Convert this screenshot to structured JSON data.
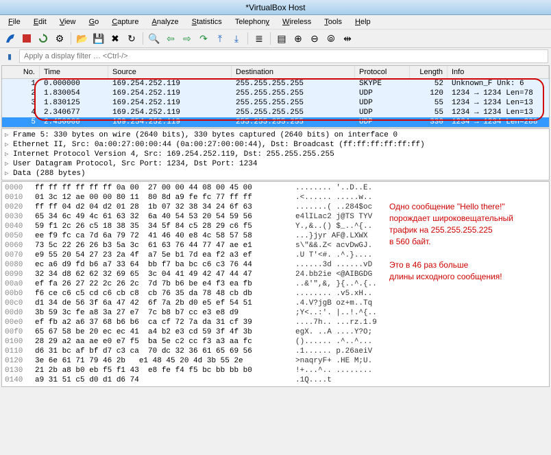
{
  "window": {
    "title": "*VirtualBox Host"
  },
  "menu": {
    "file": "File",
    "edit": "Edit",
    "view": "View",
    "go": "Go",
    "capture": "Capture",
    "analyze": "Analyze",
    "statistics": "Statistics",
    "telephony": "Telephony",
    "wireless": "Wireless",
    "tools": "Tools",
    "help": "Help"
  },
  "filter": {
    "placeholder": "Apply a display filter … <Ctrl-/>"
  },
  "columns": {
    "no": "No.",
    "time": "Time",
    "src": "Source",
    "dst": "Destination",
    "proto": "Protocol",
    "len": "Length",
    "info": "Info"
  },
  "packets": [
    {
      "no": "1",
      "time": "0.000000",
      "src": "169.254.252.119",
      "dst": "255.255.255.255",
      "proto": "SKYPE",
      "len": "52",
      "info": "Unknown_F  Unk: 6",
      "sel": false,
      "grp": true
    },
    {
      "no": "2",
      "time": "1.830054",
      "src": "169.254.252.119",
      "dst": "255.255.255.255",
      "proto": "UDP",
      "len": "120",
      "info": "1234 → 1234 Len=78",
      "sel": false,
      "grp": true
    },
    {
      "no": "3",
      "time": "1.830125",
      "src": "169.254.252.119",
      "dst": "255.255.255.255",
      "proto": "UDP",
      "len": "55",
      "info": "1234 → 1234 Len=13",
      "sel": false,
      "grp": true
    },
    {
      "no": "4",
      "time": "2.340677",
      "src": "169.254.252.119",
      "dst": "255.255.255.255",
      "proto": "UDP",
      "len": "55",
      "info": "1234 → 1234 Len=13",
      "sel": false,
      "grp": true
    },
    {
      "no": "5",
      "time": "2.450000",
      "src": "169.254.252.119",
      "dst": "255.255.255.255",
      "proto": "UDP",
      "len": "330",
      "info": "1234 → 1234 Len=288",
      "sel": true,
      "grp": true
    }
  ],
  "details": [
    "Frame 5: 330 bytes on wire (2640 bits), 330 bytes captured (2640 bits) on interface 0",
    "Ethernet II, Src: 0a:00:27:00:00:44 (0a:00:27:00:00:44), Dst: Broadcast (ff:ff:ff:ff:ff:ff)",
    "Internet Protocol Version 4, Src: 169.254.252.119, Dst: 255.255.255.255",
    "User Datagram Protocol, Src Port: 1234, Dst Port: 1234",
    "Data (288 bytes)"
  ],
  "hex": [
    {
      "off": "0000",
      "b": "ff ff ff ff ff ff 0a 00  27 00 00 44 08 00 45 00",
      "a": "........ '..D..E."
    },
    {
      "off": "0010",
      "b": "01 3c 12 ae 00 00 80 11  80 8d a9 fe fc 77 ff ff",
      "a": ".<...... .....w.."
    },
    {
      "off": "0020",
      "b": "ff ff 04 d2 04 d2 01 28  1b 07 32 38 34 24 6f 63",
      "a": ".......( ..284$oc"
    },
    {
      "off": "0030",
      "b": "65 34 6c 49 4c 61 63 32  6a 40 54 53 20 54 59 56",
      "a": "e4lILac2 j@TS TYV"
    },
    {
      "off": "0040",
      "b": "59 f1 2c 26 c5 18 38 35  34 5f 84 c5 28 29 c6 f5",
      "a": "Y.,&..() $_..^{.."
    },
    {
      "off": "0050",
      "b": "ee f9 fc ca 7d 6a 79 72  41 46 40 e8 4c 58 57 58",
      "a": "...}jyr AF@.LXWX"
    },
    {
      "off": "0060",
      "b": "73 5c 22 26 26 b3 5a 3c  61 63 76 44 77 47 ae e1",
      "a": "s\\\"&&.Z< acvDwGJ."
    },
    {
      "off": "0070",
      "b": "e9 55 20 54 27 23 2a 4f  a7 5e b1 7d ea f2 a3 ef",
      "a": ".U T'<#. .^.}...."
    },
    {
      "off": "0080",
      "b": "ec a6 d9 fd b6 a7 33 64  bb f7 ba bc c6 c3 76 44",
      "a": "......3d ......vD"
    },
    {
      "off": "0090",
      "b": "32 34 d8 62 62 32 69 65  3c 04 41 49 42 47 44 47",
      "a": "24.bb2ie <@AIBGDG"
    },
    {
      "off": "00a0",
      "b": "ef fa 26 27 22 2c 26 2c  7d 7b b6 be e4 f3 ea fb",
      "a": "..&'\",&, }{..^.{.."
    },
    {
      "off": "00b0",
      "b": "f6 ce c6 c5 cd c6 cb c8  cb 76 35 da 78 48 cb db",
      "a": "........ .v5.xH.."
    },
    {
      "off": "00c0",
      "b": "d1 34 de 56 3f 6a 47 42  6f 7a 2b d0 e5 ef 54 51",
      "a": ".4.V?jgB oz+m..Tq"
    },
    {
      "off": "00d0",
      "b": "3b 59 3c fe a8 3a 27 e7  7c b8 b7 cc e3 e8 d9   ",
      "a": ";Y<..:'. |..!.^{.."
    },
    {
      "off": "00e0",
      "b": "ef fb a2 a6 37 68 b6 b6  ca cf 72 7a da 31 cf 39",
      "a": "....7h.. ...rz.1.9"
    },
    {
      "off": "00f0",
      "b": "65 67 58 be 20 ec ec 41  a4 b2 e3 cd 59 3f 4f 3b",
      "a": "egX. ..A ....Y?O;"
    },
    {
      "off": "0100",
      "b": "28 29 a2 aa ae e0 e7 f5  ba 5e c2 cc f3 a3 aa fc",
      "a": "()...... .^..^..."
    },
    {
      "off": "0110",
      "b": "d6 31 bc af bf d7 c3 ca  70 dc 32 36 61 65 69 56",
      "a": ".1...... p.26aeiV"
    },
    {
      "off": "0120",
      "b": "3e 6e 61 71 79 46 2b   e1 48 45 20 4d 3b 55 2e",
      "a": ">naqryF+ .HE M;U."
    },
    {
      "off": "0130",
      "b": "21 2b a8 b0 eb f5 f1 43  e8 fe f4 f5 bc bb bb b0",
      "a": "!+...^.. ........"
    },
    {
      "off": "0140",
      "b": "a9 31 51 c5 d0 d1 d6 74                         ",
      "a": ".1Q....t"
    }
  ],
  "annotation": {
    "l1": "Одно сообщение \"Hello there!\"",
    "l2": "порождает широковещательный",
    "l3": "трафик на 255.255.255.225",
    "l4": "в 560 байт.",
    "l5": "Это в 46 раз больше",
    "l6": "длины исходного сообщения!"
  }
}
